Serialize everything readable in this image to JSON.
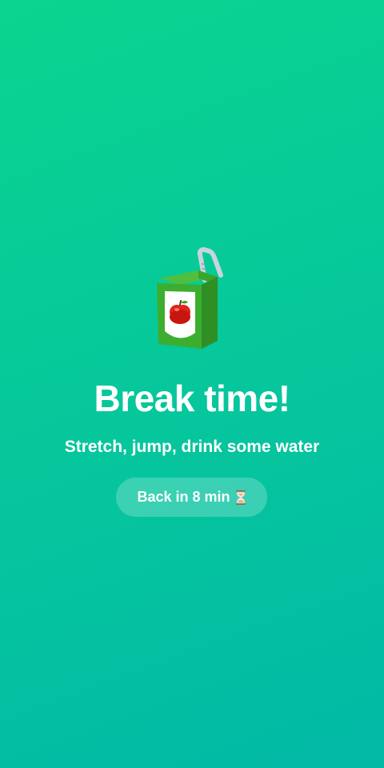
{
  "break": {
    "title": "Break time!",
    "subtitle": "Stretch, jump, drink some water",
    "countdown_label": "Back in 8 min"
  },
  "icons": {
    "hero": "juice-box-icon",
    "timer": "hourglass-icon"
  },
  "colors": {
    "background_top": "#0ad48f",
    "background_bottom": "#02b9a6",
    "text": "#ffffff"
  }
}
